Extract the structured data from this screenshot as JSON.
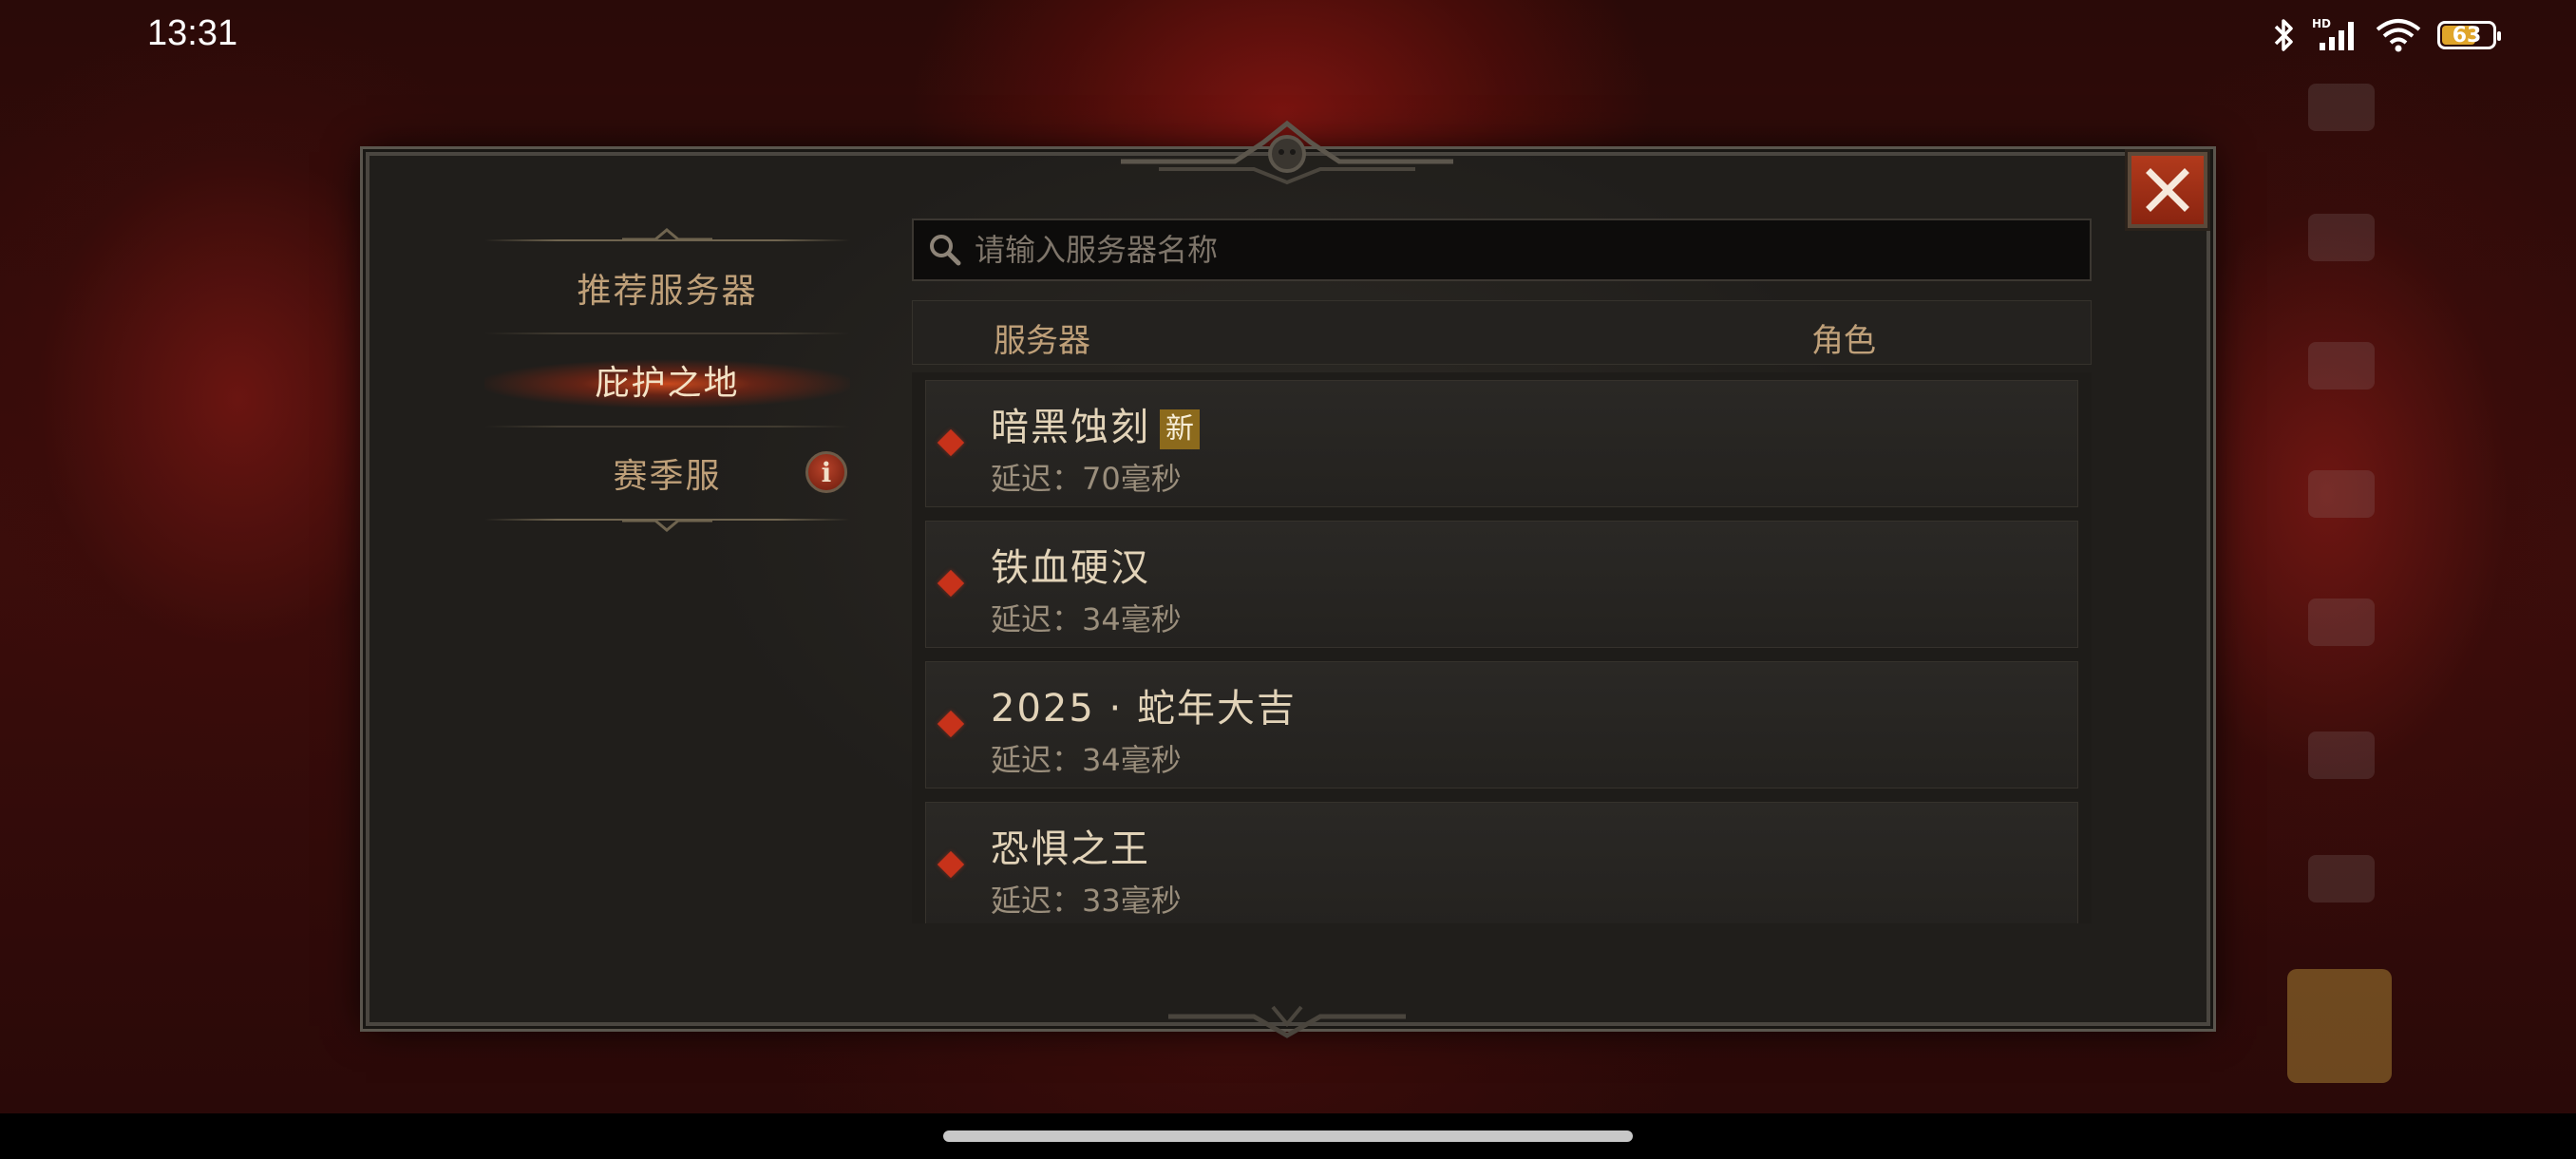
{
  "status_bar": {
    "time": "13:31",
    "battery": "63",
    "icons": [
      "bluetooth-icon",
      "hd-signal-icon",
      "wifi-icon",
      "battery-icon"
    ]
  },
  "dialog": {
    "close_icon": "close-icon",
    "menu": {
      "items": [
        {
          "label": "推荐服务器",
          "active": false
        },
        {
          "label": "庇护之地",
          "active": true
        },
        {
          "label": "赛季服",
          "active": false
        }
      ],
      "info_icon": "i"
    },
    "search": {
      "placeholder": "请输入服务器名称",
      "value": ""
    },
    "table": {
      "headers": {
        "server": "服务器",
        "role": "角色"
      },
      "rows": [
        {
          "name": "暗黑蚀刻",
          "badge": "新",
          "latency": "延迟：70毫秒"
        },
        {
          "name": "铁血硬汉",
          "badge": "",
          "latency": "延迟：34毫秒"
        },
        {
          "name": "2025 · 蛇年大吉",
          "badge": "",
          "latency": "延迟：34毫秒"
        },
        {
          "name": "恐惧之王",
          "badge": "",
          "latency": "延迟：33毫秒"
        }
      ]
    }
  },
  "colors": {
    "accent_red": "#c7321a",
    "gold_text": "#bfa079",
    "badge": "#8c6a1c"
  }
}
